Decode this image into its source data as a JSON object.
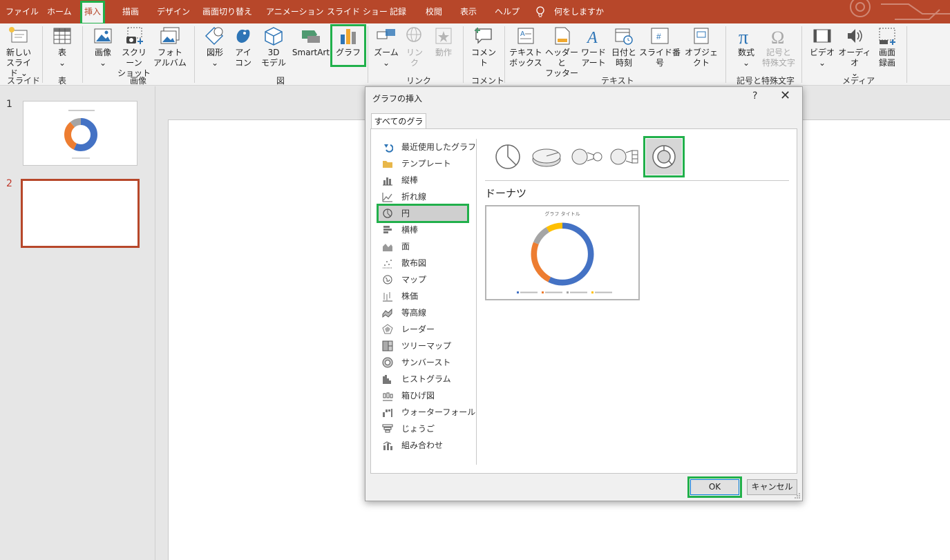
{
  "menu": {
    "items": [
      "ファイル",
      "ホーム",
      "挿入",
      "描画",
      "デザイン",
      "画面切り替え",
      "アニメーション",
      "スライド ショー",
      "記録",
      "校閲",
      "表示",
      "ヘルプ"
    ],
    "active_index": 2,
    "search_label": "何をしますか"
  },
  "ribbon": {
    "new_slide": "新しい\nスライド",
    "table": "表",
    "image": "画像",
    "screenshot": "スクリーン\nショット",
    "photo_album": "フォト\nアルバム",
    "shapes": "図形",
    "icons": "アイ\nコン",
    "model3d": "3D\nモデル",
    "smartart": "SmartArt",
    "chart": "グラフ",
    "zoom": "ズーム",
    "link": "リン\nク",
    "action": "動作",
    "comment": "コメント",
    "textbox": "テキスト\nボックス",
    "header_footer": "ヘッダーと\nフッター",
    "wordart": "ワード\nアート",
    "datetime": "日付と\n時刻",
    "slide_number": "スライド番号",
    "object": "オブジェクト",
    "equation": "数式",
    "symbol": "記号と\n特殊文字",
    "video": "ビデオ",
    "audio": "オーディオ",
    "screen_recording": "画面\n録画",
    "groups": {
      "slides": "スライド",
      "tables": "表",
      "images": "画像",
      "illustrations": "図",
      "links": "リンク",
      "comments": "コメント",
      "text": "テキスト",
      "symbols": "記号と特殊文字",
      "media": "メディア"
    }
  },
  "slides": {
    "numbers": [
      "1",
      "2"
    ],
    "active_index": 1
  },
  "dialog": {
    "title": "グラフの挿入",
    "help": "?",
    "close": "✕",
    "tab": "すべてのグラフ",
    "chart_types": [
      "最近使用したグラフ",
      "テンプレート",
      "縦棒",
      "折れ線",
      "円",
      "横棒",
      "面",
      "散布図",
      "マップ",
      "株価",
      "等高線",
      "レーダー",
      "ツリーマップ",
      "サンバースト",
      "ヒストグラム",
      "箱ひげ図",
      "ウォーターフォール",
      "じょうご",
      "組み合わせ"
    ],
    "chart_type_icons": [
      "undo-arrow-icon",
      "folder-icon",
      "column-chart-icon",
      "line-chart-icon",
      "pie-chart-icon",
      "bar-chart-icon",
      "area-chart-icon",
      "scatter-chart-icon",
      "map-chart-icon",
      "stock-chart-icon",
      "surface-chart-icon",
      "radar-chart-icon",
      "treemap-chart-icon",
      "sunburst-chart-icon",
      "histogram-chart-icon",
      "box-whisker-chart-icon",
      "waterfall-chart-icon",
      "funnel-chart-icon",
      "combo-chart-icon"
    ],
    "selected_type_index": 4,
    "subtypes": [
      "pie-icon",
      "3d-pie-icon",
      "pie-of-pie-icon",
      "bar-of-pie-icon",
      "doughnut-icon"
    ],
    "selected_subtype_index": 4,
    "subtype_name": "ドーナツ",
    "preview_title": "グラフ タイトル",
    "ok": "OK",
    "cancel": "キャンセル"
  },
  "colors": {
    "accent": "#b7472a",
    "highlight": "#21b04b",
    "series_blue": "#4472c4",
    "series_orange": "#ed7d31",
    "series_gray": "#a5a5a5",
    "series_yellow": "#ffc000"
  }
}
